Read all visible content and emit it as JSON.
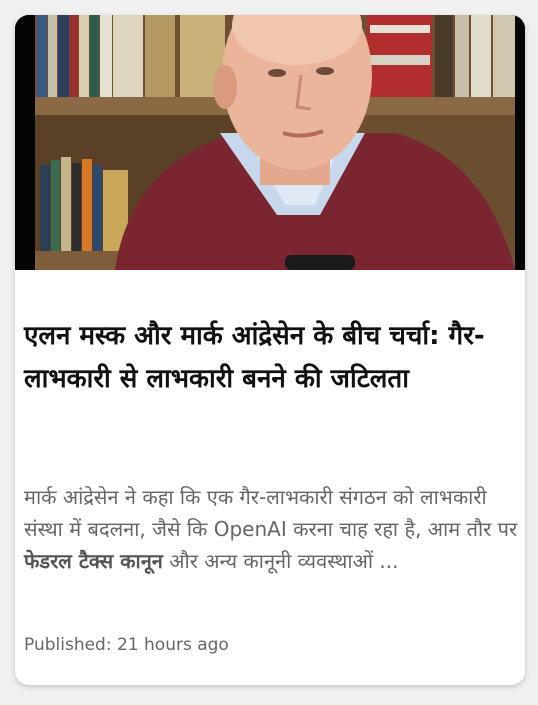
{
  "article": {
    "thumbnail_alt": "Marc Andreessen in front of a bookshelf",
    "title": "एलन मस्क और मार्क आंद्रेसेन के बीच चर्चा: गैर-लाभकारी से लाभकारी बनने की जटिलता",
    "summary_start": "मार्क आंद्रेसेन ने कहा कि एक गैर-लाभकारी संगठन को लाभकारी संस्था में बदलना, जैसे कि OpenAI करना चाह रहा है, आम तौर पर ",
    "summary_bold": "फेडरल टैक्स कानून",
    "summary_end": " और अन्य कानूनी व्यवस्थाओं ...",
    "published": "Published: 21 hours ago"
  },
  "colors": {
    "card_bg": "#ffffff",
    "page_bg": "#f0f0f0",
    "title": "#111111",
    "summary": "#666666",
    "sweater": "#7a2530"
  }
}
